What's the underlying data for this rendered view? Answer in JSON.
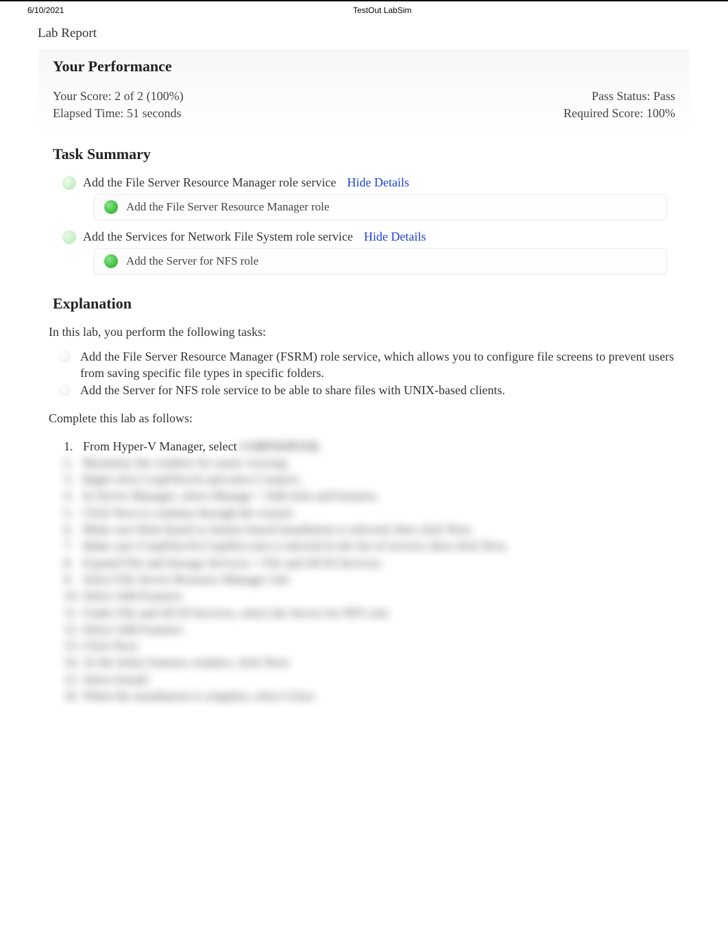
{
  "header": {
    "date": "6/10/2021",
    "title": "TestOut LabSim"
  },
  "report_title": "Lab Report",
  "performance": {
    "heading": "Your Performance",
    "score_label": "Your Score: 2 of 2 (100%)",
    "pass_status": "Pass Status: Pass",
    "elapsed": "Elapsed Time: 51 seconds",
    "required": "Required Score: 100%"
  },
  "task_summary": {
    "heading": "Task Summary",
    "hide_details": "Hide Details",
    "tasks": [
      {
        "label": "Add the File Server Resource Manager role service",
        "detail": "Add the File Server Resource Manager role"
      },
      {
        "label": "Add the Services for Network File System role service",
        "detail": "Add the Server for NFS role"
      }
    ]
  },
  "explanation": {
    "heading": "Explanation",
    "intro": "In this lab, you perform the following tasks:",
    "bullets": [
      "Add the File Server Resource Manager (FSRM) role service, which allows you to configure file screens to prevent users from saving specific file types in specific folders.",
      "Add the Server for NFS role service to be able to share files with UNIX-based clients."
    ],
    "complete": "Complete this lab as follows:",
    "step1_visible": "From Hyper-V Manager, select ",
    "blurred_steps": [
      "CORPSERVER.",
      "Maximize the window for easier viewing.",
      "Right-click CorpFiles16 and select Connect.",
      "In Server Manager, select Manage > Add roles and features.",
      "Click Next to continue through the wizard.",
      "Make sure Role-based or feature-based installation is selected; then click Next.",
      "Make sure CorpFiles16.CorpNet.com is selected in the list of servers; then click Next.",
      "Expand File and Storage Services > File and iSCSI Services.",
      "Select File Server Resource Manager role.",
      "Select Add Features.",
      "Under File and iSCSI Services, select the Server for NFS role.",
      "Select Add Features.",
      "Click Next.",
      "At the Select features window, click Next.",
      "Select Install.",
      "When the installation is complete, select Close."
    ]
  }
}
